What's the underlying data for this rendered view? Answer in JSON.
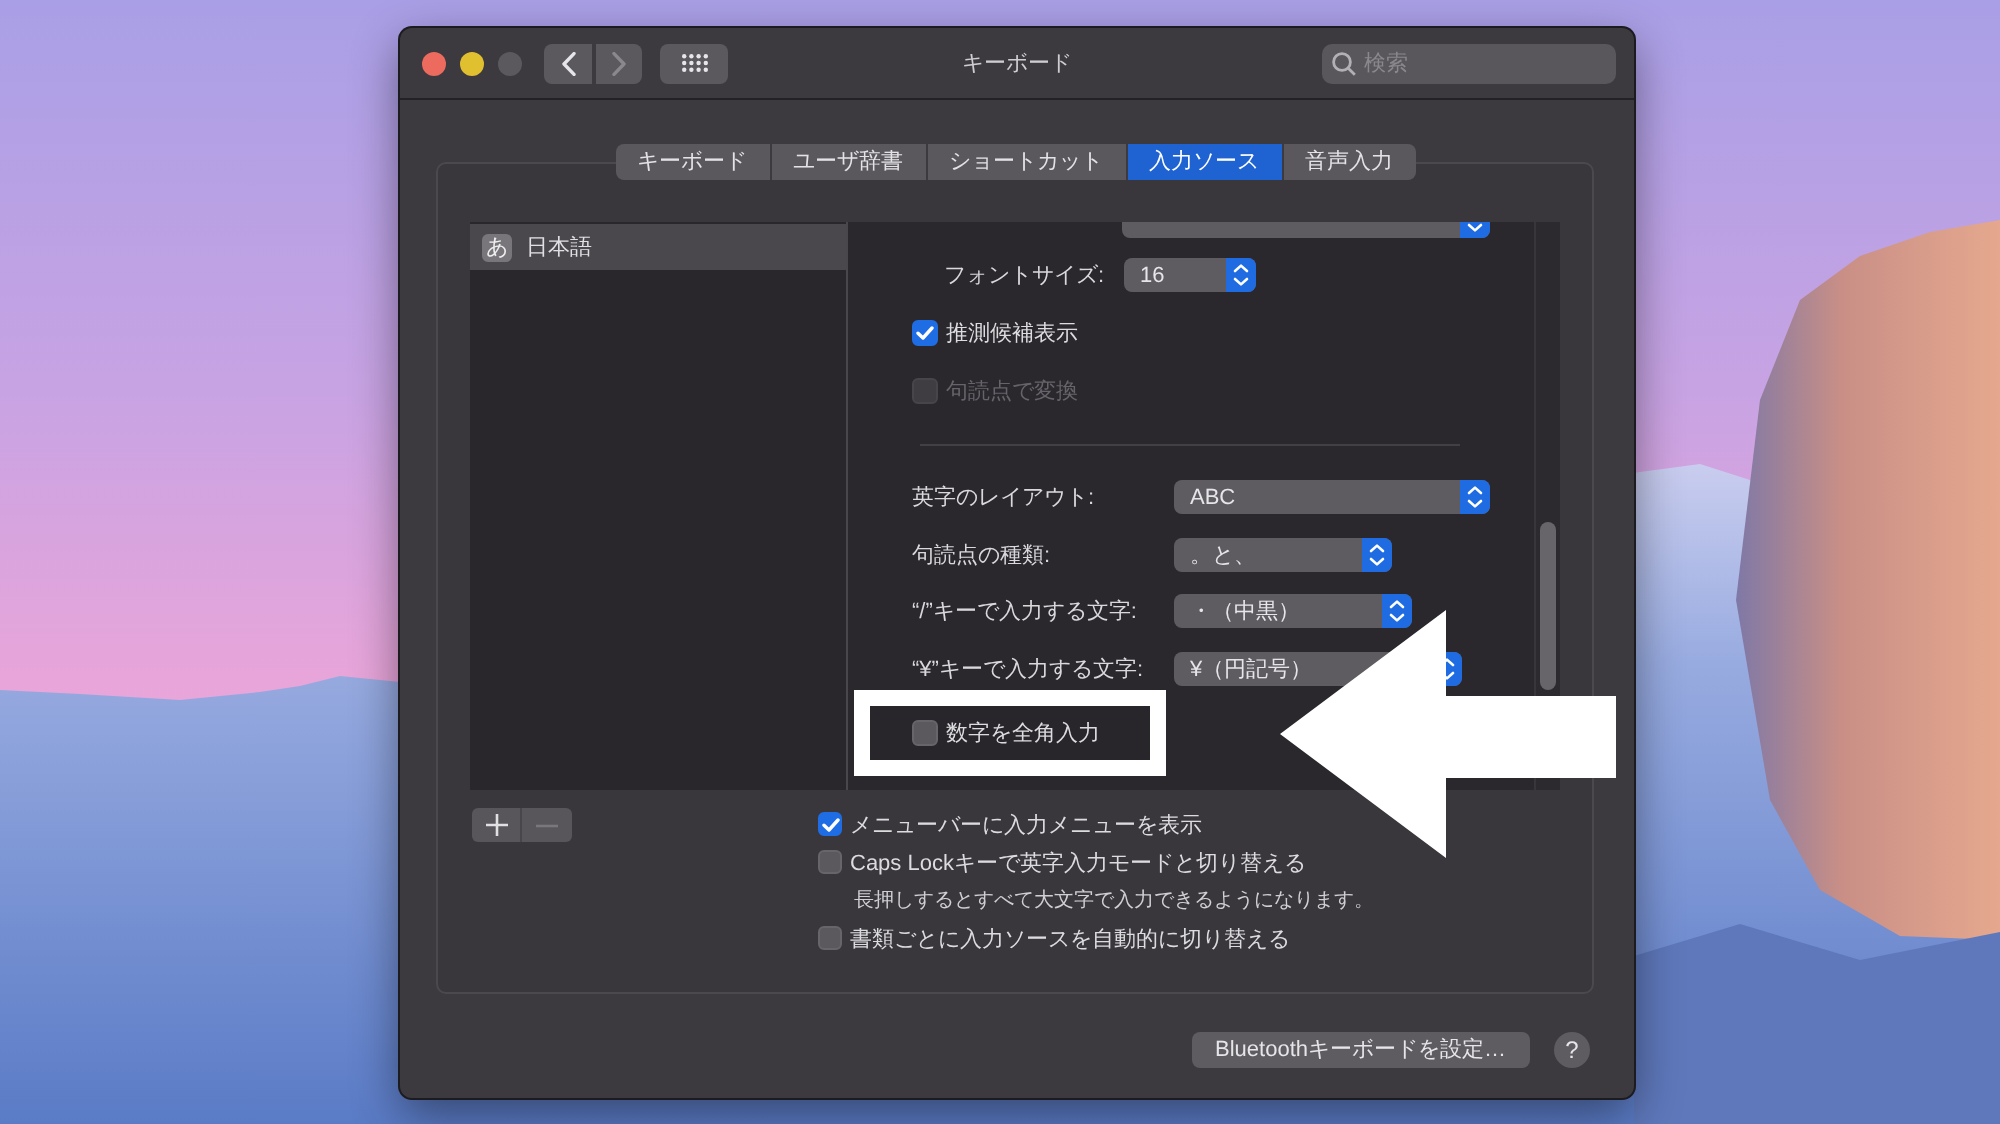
{
  "window": {
    "title": "キーボード",
    "buttons": [
      {
        "kind": "close",
        "disabled": false
      },
      {
        "kind": "minimize",
        "disabled": false
      },
      {
        "kind": "zoom",
        "disabled": true
      }
    ]
  },
  "toolbar": {
    "nav": [
      {
        "kind": "back",
        "disabled": false
      },
      {
        "kind": "forward",
        "disabled": true
      }
    ],
    "search": {
      "placeholder": "検索"
    }
  },
  "tabs": [
    {
      "label": "キーボード",
      "selected": false
    },
    {
      "label": "ユーザ辞書",
      "selected": false
    },
    {
      "label": "ショートカット",
      "selected": false
    },
    {
      "label": "入力ソース",
      "selected": true
    },
    {
      "label": "音声入力",
      "selected": false
    }
  ],
  "input_sources": [
    {
      "icon": "あ",
      "label": "日本語",
      "selected": true
    }
  ],
  "options": [
    {
      "rows": [
        {
          "kind": "popup",
          "cut_off": true
        },
        {
          "kind": "popup",
          "label": "フォントサイズ:",
          "value": "16",
          "cut_off": false
        },
        {
          "kind": "checkbox",
          "label": "推測候補表示",
          "checked": true,
          "disabled": false,
          "highlighted": false
        },
        {
          "kind": "checkbox",
          "label": "句読点で変換",
          "checked": false,
          "disabled": true,
          "highlighted": false
        }
      ]
    },
    {
      "rows": [
        {
          "kind": "popup",
          "label": "英字のレイアウト:",
          "value": "ABC",
          "cut_off": false
        },
        {
          "kind": "popup",
          "label": "句読点の種類:",
          "value": "。と、",
          "cut_off": false
        },
        {
          "kind": "popup",
          "label": "“/”キーで入力する文字:",
          "value": "・（中黒）",
          "cut_off": false
        },
        {
          "kind": "popup",
          "label": "“¥”キーで入力する文字:",
          "value": "¥（円記号）",
          "cut_off": false
        },
        {
          "kind": "checkbox",
          "label": "数字を全角入力",
          "checked": false,
          "disabled": false,
          "highlighted": true
        }
      ]
    }
  ],
  "list_buttons": [
    {
      "kind": "add",
      "disabled": false
    },
    {
      "kind": "remove",
      "disabled": true
    }
  ],
  "checkboxes": [
    {
      "label": "メニューバーに入力メニューを表示",
      "checked": true
    },
    {
      "label": "Caps Lockキーで英字入力モードと切り替える",
      "checked": false,
      "hint": "長押しするとすべて大文字で入力できるようになります。"
    },
    {
      "label": "書類ごとに入力ソースを自動的に切り替える",
      "checked": false
    }
  ],
  "footer": {
    "button": "Bluetoothキーボードを設定…",
    "help": "?"
  }
}
